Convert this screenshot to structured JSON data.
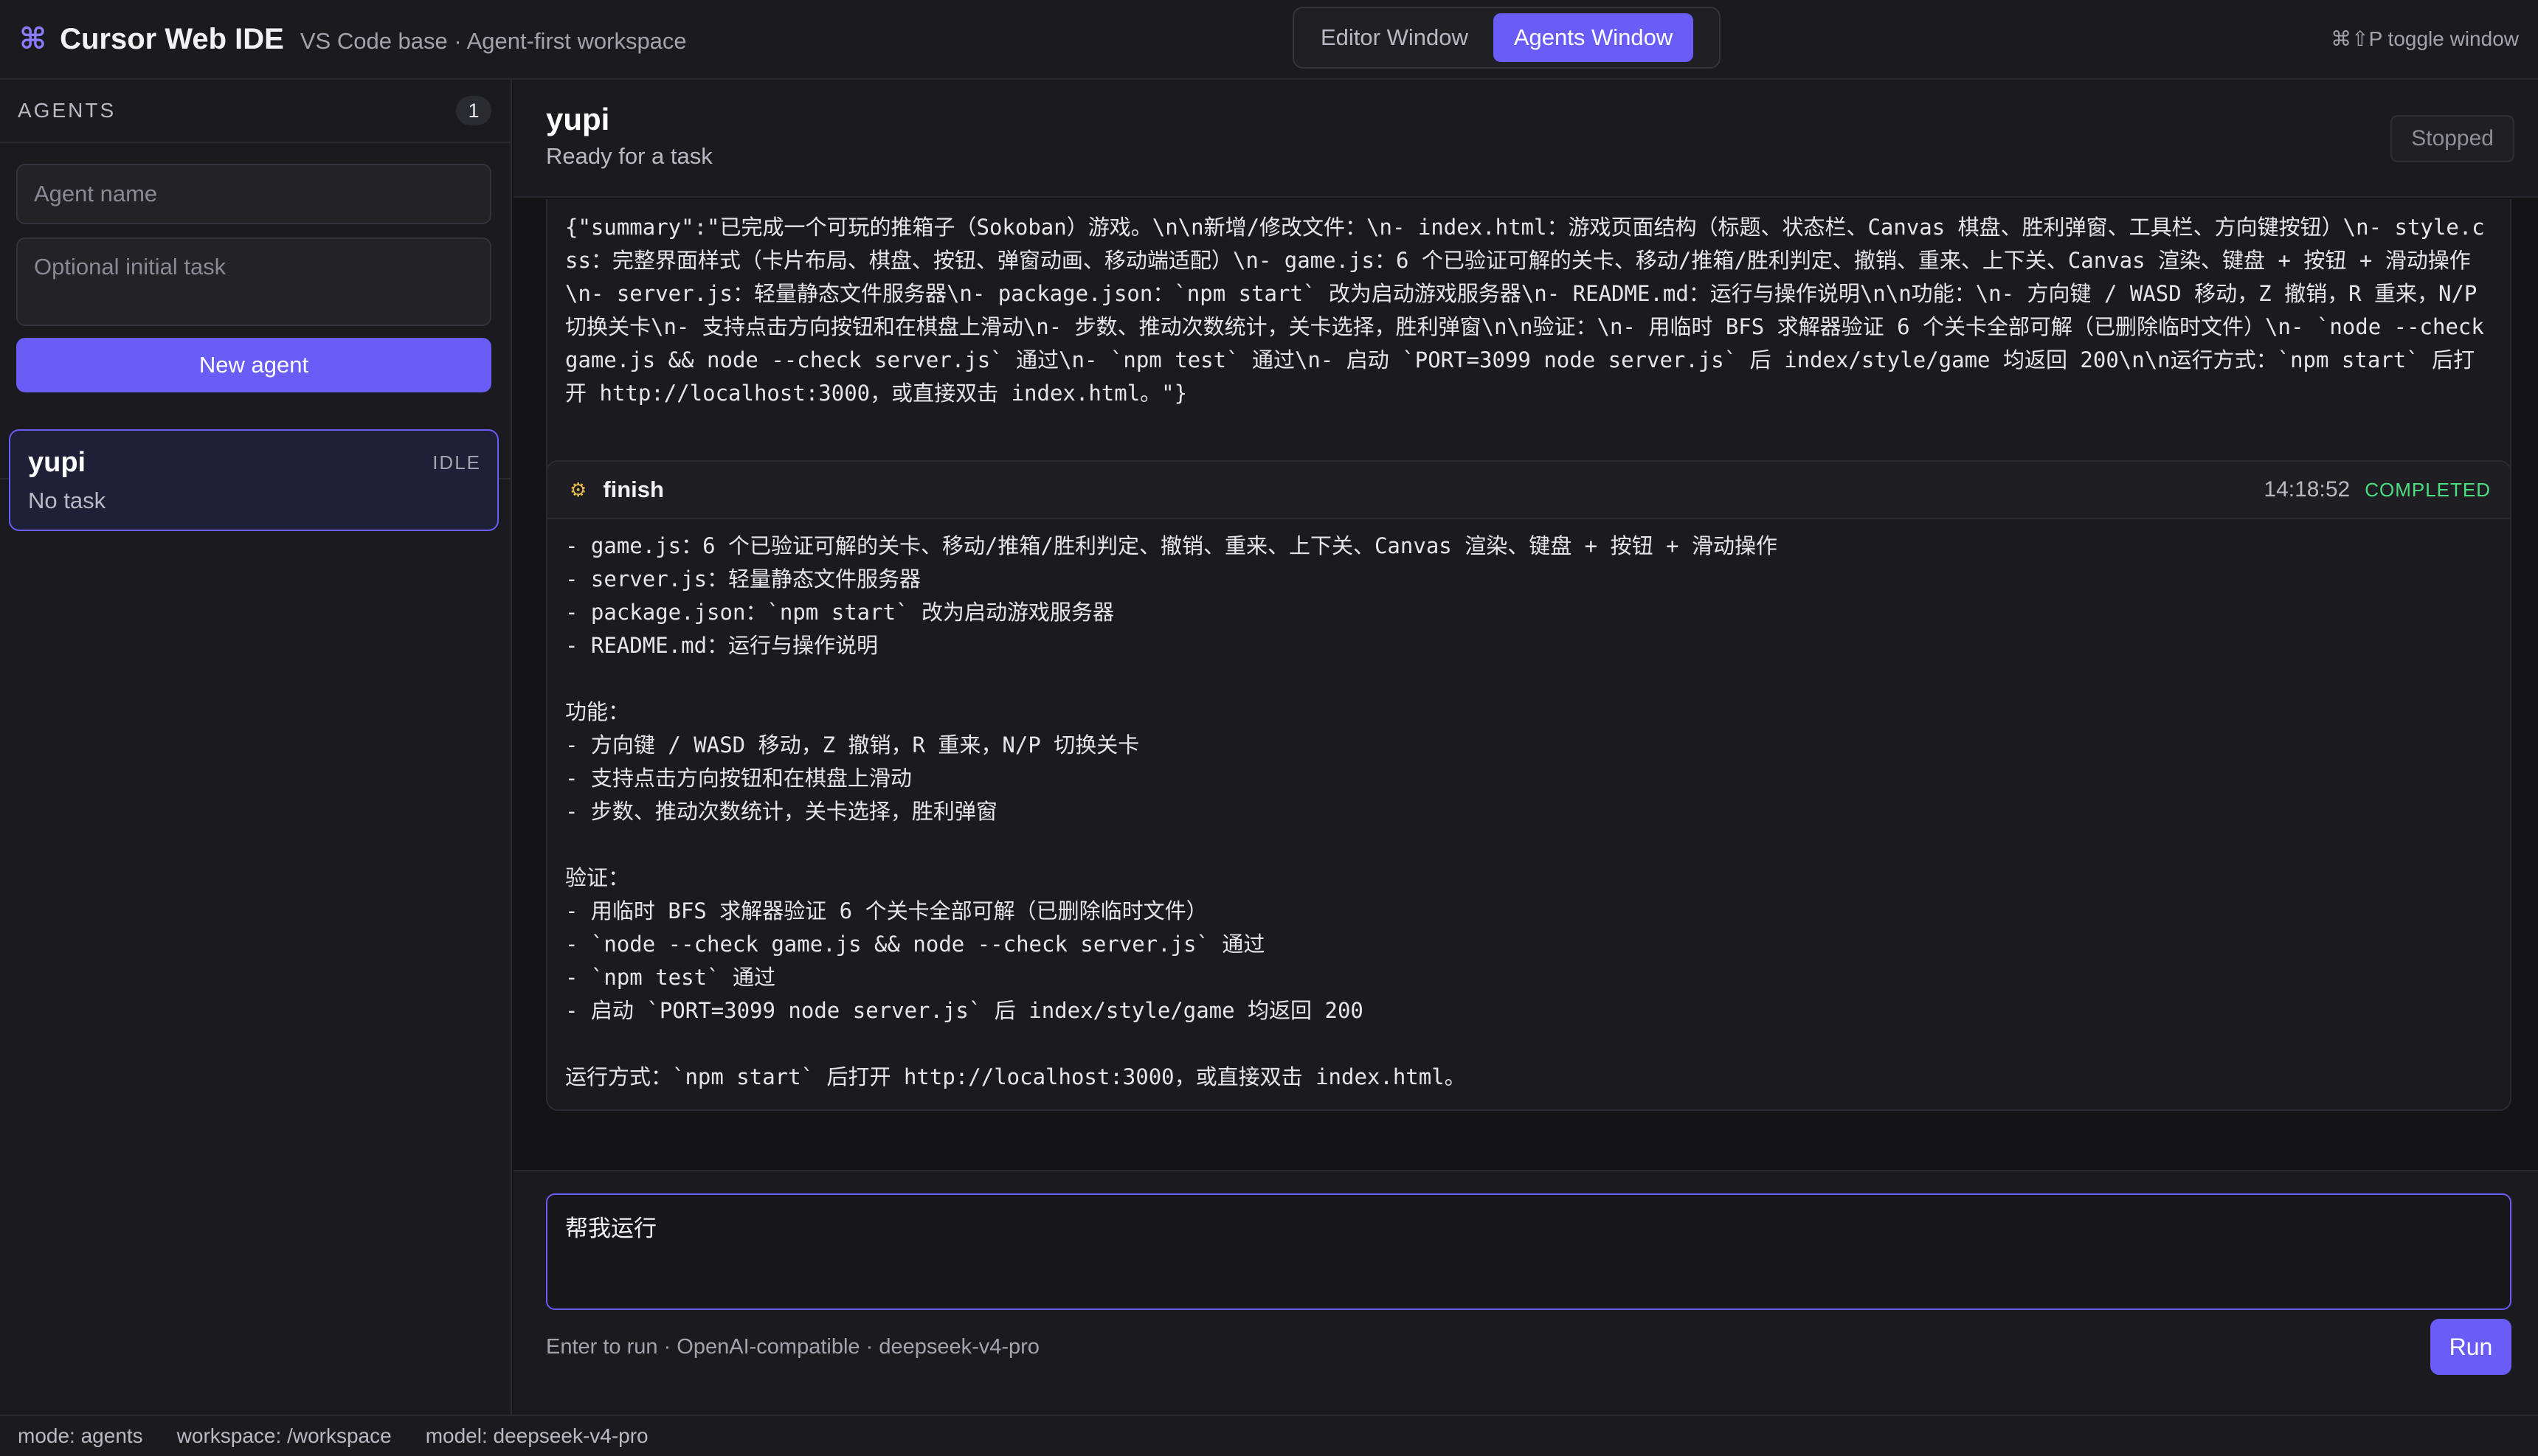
{
  "app": {
    "icon": "command-icon",
    "icon_glyph": "⌘",
    "title": "Cursor Web IDE",
    "subtitle": "VS Code base · Agent-first workspace"
  },
  "window_switch": {
    "tabs": [
      {
        "label": "Editor Window",
        "active": false
      },
      {
        "label": "Agents Window",
        "active": true
      }
    ]
  },
  "toggle_hint": "⌘⇧P toggle window",
  "sidebar": {
    "title": "AGENTS",
    "count": "1",
    "name_placeholder": "Agent name",
    "task_placeholder": "Optional initial task",
    "new_agent_label": "New agent",
    "agents": [
      {
        "name": "yupi",
        "state": "IDLE",
        "task": "No task",
        "selected": true
      }
    ]
  },
  "main": {
    "agent_name": "yupi",
    "agent_status_text": "Ready for a task",
    "run_state": "Stopped",
    "summary_text": "{\"summary\":\"已完成一个可玩的推箱子（Sokoban）游戏。\\n\\n新增/修改文件：\\n- index.html：游戏页面结构（标题、状态栏、Canvas 棋盘、胜利弹窗、工具栏、方向键按钮）\\n- style.css：完整界面样式（卡片布局、棋盘、按钮、弹窗动画、移动端适配）\\n- game.js：6 个已验证可解的关卡、移动/推箱/胜利判定、撤销、重来、上下关、Canvas 渲染、键盘 + 按钮 + 滑动操作\\n- server.js：轻量静态文件服务器\\n- package.json：`npm start` 改为启动游戏服务器\\n- README.md：运行与操作说明\\n\\n功能：\\n- 方向键 / WASD 移动，Z 撤销，R 重来，N/P 切换关卡\\n- 支持点击方向按钮和在棋盘上滑动\\n- 步数、推动次数统计，关卡选择，胜利弹窗\\n\\n验证：\\n- 用临时 BFS 求解器验证 6 个关卡全部可解（已删除临时文件）\\n- `node --check game.js && node --check server.js` 通过\\n- `npm test` 通过\\n- 启动 `PORT=3099 node server.js` 后 index/style/game 均返回 200\\n\\n运行方式：`npm start` 后打开 http://localhost:3000，或直接双击 index.html。\"}",
    "finish": {
      "icon": "gear-icon",
      "icon_glyph": "⚙",
      "title": "finish",
      "time": "14:18:52",
      "state": "COMPLETED",
      "body_text": "- game.js：6 个已验证可解的关卡、移动/推箱/胜利判定、撤销、重来、上下关、Canvas 渲染、键盘 + 按钮 + 滑动操作\n- server.js：轻量静态文件服务器\n- package.json：`npm start` 改为启动游戏服务器\n- README.md：运行与操作说明\n\n功能：\n- 方向键 / WASD 移动，Z 撤销，R 重来，N/P 切换关卡\n- 支持点击方向按钮和在棋盘上滑动\n- 步数、推动次数统计，关卡选择，胜利弹窗\n\n验证：\n- 用临时 BFS 求解器验证 6 个关卡全部可解（已删除临时文件）\n- `node --check game.js && node --check server.js` 通过\n- `npm test` 通过\n- 启动 `PORT=3099 node server.js` 后 index/style/game 均返回 200\n\n运行方式：`npm start` 后打开 http://localhost:3000，或直接双击 index.html。"
    },
    "prompt_value": "帮我运行",
    "composer_hint": "Enter to run · OpenAI-compatible · deepseek-v4-pro",
    "run_label": "Run"
  },
  "statusbar": {
    "mode": "mode: agents",
    "workspace": "workspace: /workspace",
    "model": "model: deepseek-v4-pro"
  },
  "colors": {
    "accent": "#6a5cf6",
    "completed": "#4ade80",
    "background": "#17171a"
  }
}
